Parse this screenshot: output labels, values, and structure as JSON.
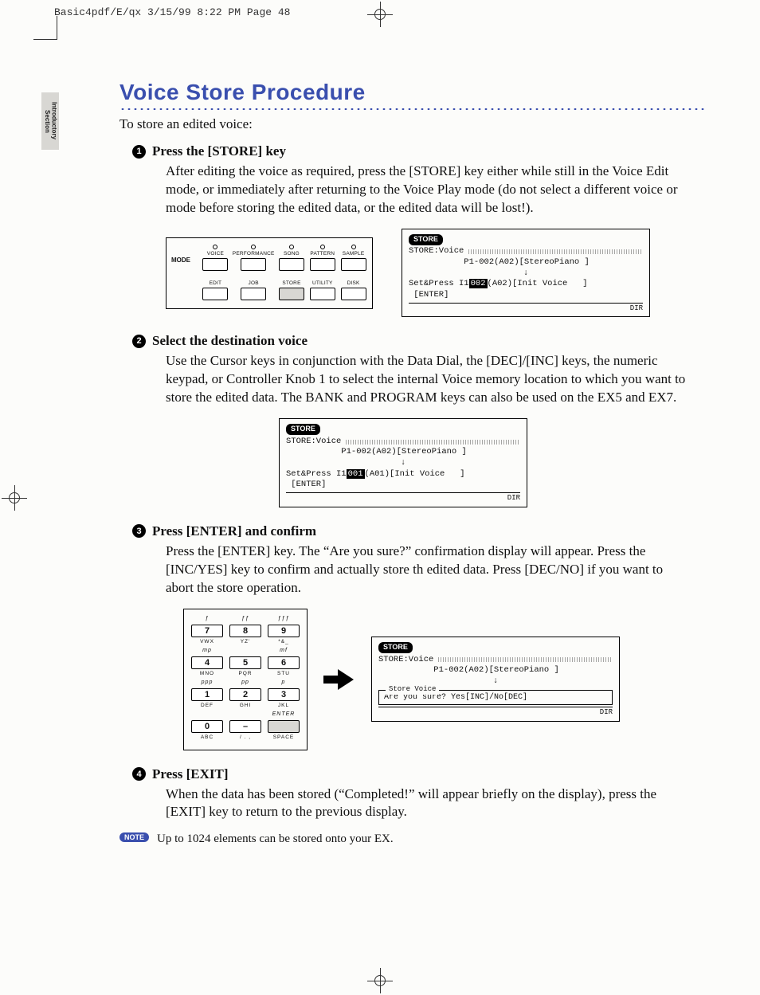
{
  "header_slug": "Basic4pdf/E/qx  3/15/99  8:22 PM  Page 48",
  "side_tab": "Introductory\nSection",
  "title": "Voice Store Procedure",
  "intro": "To store an edited voice:",
  "page_number": "48",
  "steps": {
    "s1": {
      "num": "1",
      "heading": "Press the [STORE] key",
      "body": "After editing the voice as required, press the [STORE] key either while still in the Voice Edit mode, or immediately after returning to the Voice Play mode (do not select a different voice or mode before storing the edited data, or the edited data will be lost!)."
    },
    "s2": {
      "num": "2",
      "heading": "Select the destination voice",
      "body": "Use the Cursor keys in conjunction with the Data Dial, the [DEC]/[INC] keys, the numeric keypad, or Controller Knob 1 to select the internal Voice memory location to which you want to store the edited data. The BANK and PROGRAM keys can also be used on the EX5 and EX7."
    },
    "s3": {
      "num": "3",
      "heading": "Press [ENTER] and confirm",
      "body": "Press the [ENTER] key. The “Are you sure?” confirmation display will appear. Press the [INC/YES] key to confirm and actually store th edited data. Press [DEC/NO] if you want to abort the store operation."
    },
    "s4": {
      "num": "4",
      "heading": "Press [EXIT]",
      "body": "When the data has been stored (“Completed!” will appear briefly on the display), press the [EXIT] key to return to the previous display."
    }
  },
  "note": {
    "badge": "NOTE",
    "text": "Up to 1024 elements can be stored onto your EX."
  },
  "mode_panel": {
    "side": "MODE",
    "row1": [
      "VOICE",
      "PERFORMANCE",
      "SONG",
      "PATTERN",
      "SAMPLE"
    ],
    "row2": [
      "EDIT",
      "JOB",
      "STORE",
      "UTILITY",
      "DISK"
    ],
    "active_row2_index": 2
  },
  "lcd_common": {
    "tag": "STORE",
    "wave_label": "STORE:Voice",
    "dir": "DIR"
  },
  "lcd1": {
    "src_line": "           P1-002(A02)[StereoPiano ]",
    "set_label": "Set&Press",
    "enter": " [ENTER]",
    "dest_pre": " I1",
    "dest_hi": "002",
    "dest_post": "(A02)[Init Voice   ]"
  },
  "lcd2": {
    "src_line": "           P1-002(A02)[StereoPiano ]",
    "set_label": "Set&Press",
    "enter": " [ENTER]",
    "dest_pre": " I1",
    "dest_hi": "001",
    "dest_post": "(A01)[Init Voice   ]"
  },
  "lcd3": {
    "src_line": "           P1-002(A02)[StereoPiano ]",
    "confirm_title": "Store Voice",
    "confirm_body": "Are you sure?  Yes[INC]/No[DEC]"
  },
  "keypad": {
    "rows": [
      {
        "top": [
          "ƒ",
          "ƒƒ",
          "ƒƒƒ"
        ],
        "keys": [
          "7",
          "8",
          "9"
        ],
        "bot": [
          "VWX",
          "YZ'",
          "*&_"
        ]
      },
      {
        "top": [
          "mp",
          "",
          "mf"
        ],
        "keys": [
          "4",
          "5",
          "6"
        ],
        "bot": [
          "MNO",
          "PQR",
          "STU"
        ]
      },
      {
        "top": [
          "ppp",
          "pp",
          "p"
        ],
        "keys": [
          "1",
          "2",
          "3"
        ],
        "bot": [
          "DEF",
          "GHI",
          "JKL"
        ]
      },
      {
        "top": [
          "",
          "",
          "ENTER"
        ],
        "keys": [
          "0",
          "–",
          ""
        ],
        "bot": [
          "ABC",
          "/ . ,",
          "SPACE"
        ]
      }
    ]
  }
}
